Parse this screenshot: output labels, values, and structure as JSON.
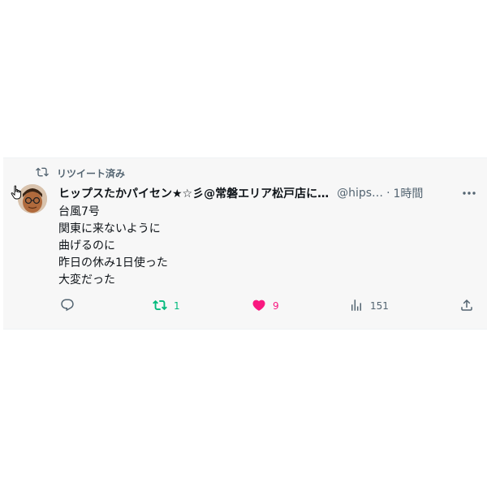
{
  "retweet_header": {
    "label": "リツイート済み",
    "icon": "retweet-icon"
  },
  "author": {
    "display_name": "ヒップスたかパイセン★☆彡@常磐エリア松戸店に…",
    "handle": "@hips…",
    "separator": "·",
    "time": "1時間"
  },
  "tweet_text": [
    "台風7号",
    "関東に来ないように",
    "曲げるのに",
    "昨日の休み1日使った",
    "大変だった"
  ],
  "actions": {
    "reply": {
      "icon": "reply-icon",
      "count": ""
    },
    "retweet": {
      "icon": "retweet-icon",
      "count": "1",
      "color": "#00ba7c"
    },
    "like": {
      "icon": "heart-icon",
      "count": "9",
      "color": "#f91880"
    },
    "views": {
      "icon": "views-icon",
      "count": "151"
    },
    "share": {
      "icon": "share-icon"
    }
  },
  "colors": {
    "secondary_text": "#536471",
    "background": "#f7f7f7"
  }
}
